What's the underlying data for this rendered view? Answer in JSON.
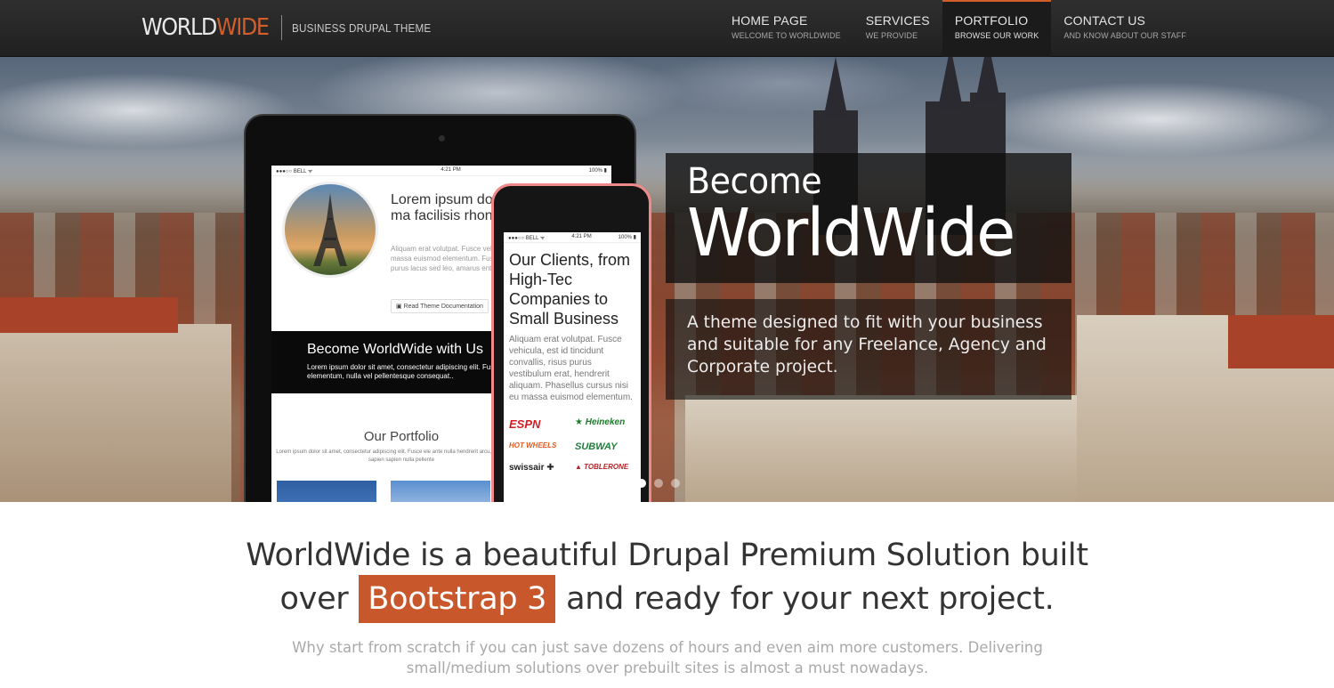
{
  "header": {
    "logo": {
      "main": "WORLD",
      "accent": "WIDE",
      "tagline": "BUSINESS DRUPAL THEME"
    },
    "nav": [
      {
        "title": "HOME PAGE",
        "subtitle": "WELCOME TO WORLDWIDE",
        "active": false
      },
      {
        "title": "SERVICES",
        "subtitle": "WE PROVIDE",
        "active": false
      },
      {
        "title": "PORTFOLIO",
        "subtitle": "BROWSE OUR WORK",
        "active": true
      },
      {
        "title": "CONTACT US",
        "subtitle": "AND KNOW ABOUT OUR STAFF",
        "active": false
      }
    ]
  },
  "hero": {
    "slide_title_small": "Become",
    "slide_title_big": "WorldWide",
    "slide_description": "A theme designed to fit with your business and suitable for any Freelance, Agency and Corporate project.",
    "slide_count": 3,
    "active_slide": 1,
    "tablet": {
      "status_left": "●●●○○ BELL ᯤ",
      "status_time": "4:21 PM",
      "status_right": "100% ▮",
      "heading": "Lorem ipsum dolor vestibulum et ma facilisis rhoncus",
      "text": "Aliquam erat volutpat. Fusce veh purus vestibulum erat, hend massa euismod elementum. Fus pellentesque consequat, ante ne purus lacus sed leo, amarus enti",
      "button": "Read Theme Documentation",
      "banner_title": "Become WorldWide with Us",
      "banner_text": "Lorem ipsum dolor sit amet, consectetur adipiscing elit. Fusce elementum, nulla vel pellentesque consequat..",
      "portfolio_title": "Our Portfolio",
      "portfolio_text": "Lorem ipsum dolor sit amet, consectetur adipiscing elit. Fusce ele ante nulla hendrerit arcu, ut ullamcorper sapien sapien nulla pellente"
    },
    "phone": {
      "status_left": "●●●○○ BELL ᯤ",
      "status_time": "4:21 PM",
      "status_right": "100% ▮",
      "heading": "Our Clients, from High-Tec Companies to Small Business",
      "text": "Aliquam erat volutpat. Fusce vehicula, est id tincidunt convallis, risus purus vestibulum erat, hendrerit aliquam. Phasellus cursus nisi eu massa euismod elementum.",
      "client_logos": [
        "ESPN",
        "★ Heineken",
        "HOT WHEELS",
        "SUBWAY",
        "swissair ✚",
        "▲ TOBLERONE"
      ]
    }
  },
  "intro": {
    "line1": "WorldWide is a beautiful Drupal Premium Solution built",
    "line2_pre": "over",
    "line2_highlight": "Bootstrap 3",
    "line2_post": "and ready for your next project.",
    "subtext": "Why start from scratch if you can just save dozens of hours and even aim more customers. Delivering small/medium solutions over prebuilt sites is almost a must nowadays."
  },
  "colors": {
    "accent": "#d25e2c",
    "highlight_bg": "#c9572c",
    "header_bg": "#262626"
  }
}
